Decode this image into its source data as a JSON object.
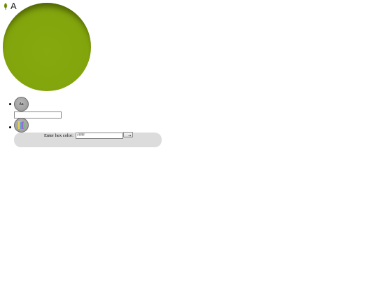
{
  "header": {
    "icon": "leaf-icon",
    "letter": "A"
  },
  "preview": {
    "color": "#82a40c"
  },
  "tools": {
    "font_button": {
      "icon": "font-icon",
      "label": "Aa"
    },
    "font_input": {
      "value": ""
    },
    "color_button": {
      "icon": "color-swatches-icon"
    },
    "hex": {
      "label": "Enter hex color:",
      "placeholder": "#ffffff",
      "submit_icon": "arrow-right-icon",
      "submit_label": "→"
    }
  },
  "colors": {
    "preview": "#82a40c",
    "panel": "#dcdcdc",
    "button": "#9f9f9f"
  }
}
